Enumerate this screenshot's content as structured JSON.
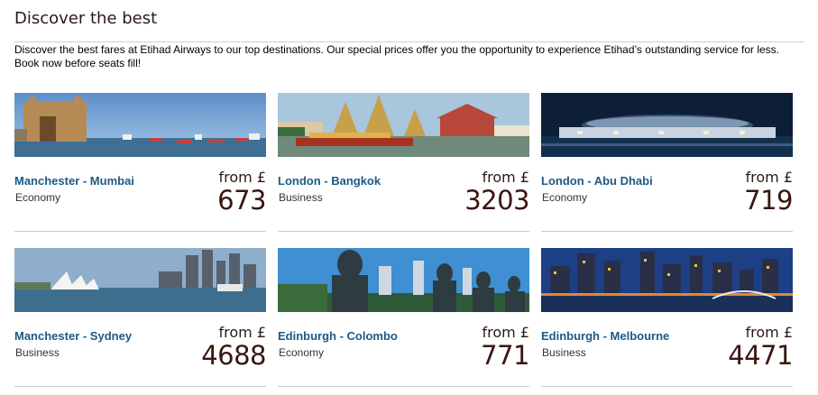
{
  "section": {
    "title": "Discover the best",
    "intro": "Discover the best fares at Etihad Airways to our top destinations. Our special prices offer you the opportunity to experience Etihad’s outstanding service for less. Book now before seats fill!"
  },
  "deals": [
    {
      "route": "Manchester - Mumbai",
      "cabin": "Economy",
      "from_label": "from £",
      "price": "673",
      "image": "mumbai-gateway-image"
    },
    {
      "route": "London - Bangkok",
      "cabin": "Business",
      "from_label": "from £",
      "price": "3203",
      "image": "bangkok-temple-image"
    },
    {
      "route": "London - Abu Dhabi",
      "cabin": "Economy",
      "from_label": "from £",
      "price": "719",
      "image": "abu-dhabi-louvre-image"
    },
    {
      "route": "Manchester - Sydney",
      "cabin": "Business",
      "from_label": "from £",
      "price": "4688",
      "image": "sydney-harbour-image"
    },
    {
      "route": "Edinburgh - Colombo",
      "cabin": "Economy",
      "from_label": "from £",
      "price": "771",
      "image": "colombo-buddha-image"
    },
    {
      "route": "Edinburgh - Melbourne",
      "cabin": "Business",
      "from_label": "from £",
      "price": "4471",
      "image": "melbourne-skyline-image"
    }
  ],
  "colors": {
    "route_link": "#1c5a86",
    "price": "#3a1610",
    "heading": "#2a1a14"
  }
}
